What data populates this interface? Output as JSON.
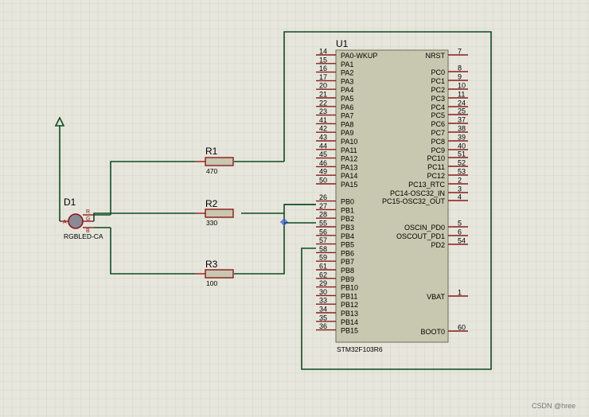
{
  "mcu": {
    "ref": "U1",
    "part": "STM32F103R6",
    "left_pins": [
      {
        "num": "14",
        "name": "PA0-WKUP"
      },
      {
        "num": "15",
        "name": "PA1"
      },
      {
        "num": "16",
        "name": "PA2"
      },
      {
        "num": "17",
        "name": "PA3"
      },
      {
        "num": "20",
        "name": "PA4"
      },
      {
        "num": "21",
        "name": "PA5"
      },
      {
        "num": "22",
        "name": "PA6"
      },
      {
        "num": "23",
        "name": "PA7"
      },
      {
        "num": "41",
        "name": "PA8"
      },
      {
        "num": "42",
        "name": "PA9"
      },
      {
        "num": "43",
        "name": "PA10"
      },
      {
        "num": "44",
        "name": "PA11"
      },
      {
        "num": "45",
        "name": "PA12"
      },
      {
        "num": "46",
        "name": "PA13"
      },
      {
        "num": "49",
        "name": "PA14"
      },
      {
        "num": "50",
        "name": "PA15"
      },
      {
        "num": "26",
        "name": "PB0"
      },
      {
        "num": "27",
        "name": "PB1"
      },
      {
        "num": "28",
        "name": "PB2"
      },
      {
        "num": "55",
        "name": "PB3"
      },
      {
        "num": "56",
        "name": "PB4"
      },
      {
        "num": "57",
        "name": "PB5"
      },
      {
        "num": "58",
        "name": "PB6"
      },
      {
        "num": "59",
        "name": "PB7"
      },
      {
        "num": "61",
        "name": "PB8"
      },
      {
        "num": "62",
        "name": "PB9"
      },
      {
        "num": "29",
        "name": "PB10"
      },
      {
        "num": "30",
        "name": "PB11"
      },
      {
        "num": "33",
        "name": "PB12"
      },
      {
        "num": "34",
        "name": "PB13"
      },
      {
        "num": "35",
        "name": "PB14"
      },
      {
        "num": "36",
        "name": "PB15"
      }
    ],
    "right_pins": [
      {
        "num": "7",
        "name": "NRST"
      },
      {
        "num": "8",
        "name": "PC0"
      },
      {
        "num": "9",
        "name": "PC1"
      },
      {
        "num": "10",
        "name": "PC2"
      },
      {
        "num": "11",
        "name": "PC3"
      },
      {
        "num": "24",
        "name": "PC4"
      },
      {
        "num": "25",
        "name": "PC5"
      },
      {
        "num": "37",
        "name": "PC6"
      },
      {
        "num": "38",
        "name": "PC7"
      },
      {
        "num": "39",
        "name": "PC8"
      },
      {
        "num": "40",
        "name": "PC9"
      },
      {
        "num": "51",
        "name": "PC10"
      },
      {
        "num": "52",
        "name": "PC11"
      },
      {
        "num": "53",
        "name": "PC12"
      },
      {
        "num": "2",
        "name": "PC13_RTC"
      },
      {
        "num": "3",
        "name": "PC14-OSC32_IN"
      },
      {
        "num": "4",
        "name": "PC15-OSC32_OUT"
      },
      {
        "num": "5",
        "name": "OSCIN_PD0"
      },
      {
        "num": "6",
        "name": "OSCOUT_PD1"
      },
      {
        "num": "54",
        "name": "PD2"
      },
      {
        "num": "1",
        "name": "VBAT"
      },
      {
        "num": "60",
        "name": "BOOT0"
      }
    ]
  },
  "resistors": [
    {
      "ref": "R1",
      "value": "470"
    },
    {
      "ref": "R2",
      "value": "330"
    },
    {
      "ref": "R3",
      "value": "100"
    }
  ],
  "led": {
    "ref": "D1",
    "part": "RGBLED-CA",
    "pin_a": "A",
    "pin_r": "R",
    "pin_g": "G",
    "pin_b": "B"
  },
  "watermark": "CSDN @hree",
  "colors": {
    "background": "#e6e6dc",
    "component_fill": "#c8c8b0",
    "wire": "#0f4a22",
    "pin": "#8b1a1a"
  }
}
